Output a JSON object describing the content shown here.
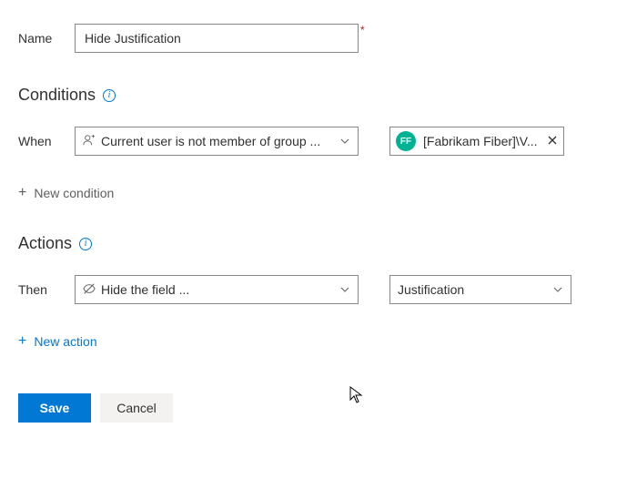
{
  "name": {
    "label": "Name",
    "value": "Hide Justification",
    "required_mark": "*"
  },
  "conditions": {
    "header": "Conditions",
    "when_label": "When",
    "dropdown_text": "Current user is not member of group ...",
    "chip": {
      "initials": "FF",
      "text": "[Fabrikam Fiber]\\V..."
    },
    "add_label": "New condition"
  },
  "actions": {
    "header": "Actions",
    "then_label": "Then",
    "action_dropdown_text": "Hide the field ...",
    "field_dropdown_text": "Justification",
    "add_label": "New action"
  },
  "buttons": {
    "save": "Save",
    "cancel": "Cancel"
  }
}
